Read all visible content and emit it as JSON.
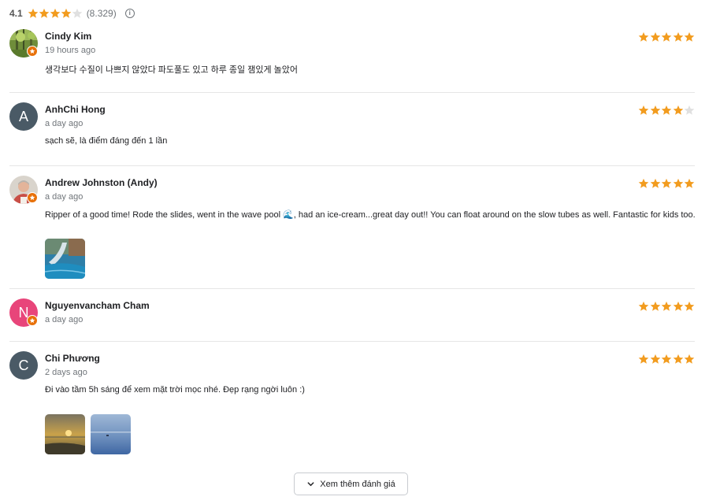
{
  "summary": {
    "score": "4.1",
    "stars_filled": 4,
    "count": "(8.329)",
    "info_icon": "info-icon"
  },
  "colors": {
    "star": "#f29c1f",
    "star_empty": "#e0e0e0",
    "badge": "#e8710a"
  },
  "reviews": [
    {
      "name": "Cindy Kim",
      "time": "19 hours ago",
      "text": "생각보다 수질이 나쁘지 않았다 파도풀도 있고 하루 종일 잼있게 놀았어",
      "rating": 5,
      "avatar": "photo-forest",
      "local_guide": true
    },
    {
      "name": "AnhChi Hong",
      "time": "a day ago",
      "text": "sạch sẽ, là điểm đáng đến 1 lần",
      "rating": 4,
      "avatar": "letter",
      "avatar_letter": "A",
      "avatar_color": "#4a5a66",
      "local_guide": false
    },
    {
      "name": "Andrew Johnston (Andy)",
      "time": "a day ago",
      "text": "Ripper of a good time! Rode the slides, went in the wave pool 🌊, had an ice-cream...great day out!! You can float around on the slow tubes as well. Fantastic for kids too.",
      "rating": 5,
      "avatar": "photo-man",
      "local_guide": true,
      "photos": [
        "waterslide-photo"
      ]
    },
    {
      "name": "Nguyenvancham Cham",
      "time": "a day ago",
      "text": "",
      "rating": 5,
      "avatar": "letter",
      "avatar_letter": "N",
      "avatar_color": "#e8457a",
      "local_guide": true
    },
    {
      "name": "Chi Phương",
      "time": "2 days ago",
      "text": "Đi vào tầm 5h sáng để xem mặt trời mọc nhé. Đẹp rạng ngời luôn :)",
      "rating": 5,
      "avatar": "letter",
      "avatar_letter": "C",
      "avatar_color": "#4a5a66",
      "local_guide": false,
      "photos": [
        "sunrise-photo",
        "sea-photo"
      ]
    }
  ],
  "more_button": {
    "label": "Xem thêm đánh giá",
    "icon": "chevron-down-icon"
  }
}
